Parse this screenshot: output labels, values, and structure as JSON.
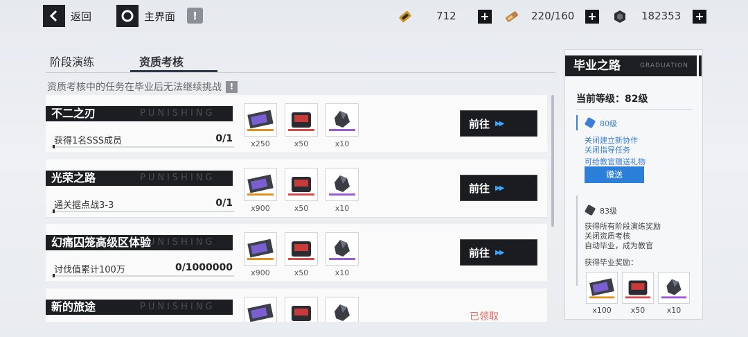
{
  "topbar": {
    "back_label": "返回",
    "home_label": "主界面",
    "warn_glyph": "!",
    "resources": [
      {
        "icon": "ticket-icon",
        "value": "712"
      },
      {
        "icon": "battery-icon",
        "value": "220/160"
      },
      {
        "icon": "coin-icon",
        "value": "182353"
      }
    ],
    "plus_glyph": "+"
  },
  "tabs": [
    "阶段演练",
    "资质考核"
  ],
  "active_tab": 1,
  "notice": {
    "text": "资质考核中的任务在毕业后无法继续挑战",
    "icon": "!"
  },
  "tasks": [
    {
      "title": "不二之刃",
      "watermark": "PUNISHING",
      "task": "获得1名SSS成员",
      "progress": "0/1",
      "rewards": [
        "x250",
        "x50",
        "x10"
      ],
      "action": "前往",
      "claimed": ""
    },
    {
      "title": "光荣之路",
      "watermark": "PUNISHING",
      "task": "通关据点战3-3",
      "progress": "0/1",
      "rewards": [
        "x900",
        "x50",
        "x10"
      ],
      "action": "前往",
      "claimed": ""
    },
    {
      "title": "幻痛囚笼高级区体验",
      "watermark": "PUNISHING",
      "task": "讨伐值累计100万",
      "progress": "0/1000000",
      "rewards": [
        "x900",
        "x50",
        "x10"
      ],
      "action": "前往",
      "claimed": ""
    },
    {
      "title": "新的旅途",
      "watermark": "PUNISHING",
      "task": "",
      "progress": "",
      "rewards": [
        "",
        "",
        ""
      ],
      "action": "",
      "claimed": "已领取"
    }
  ],
  "side": {
    "title": "毕业之路",
    "title_en": "GRADUATION",
    "current_level": "当前等级：82级",
    "level80": {
      "name": "80级",
      "lines": [
        "关闭建立新协作",
        "关闭指导任务"
      ],
      "extra": "可给教官赠送礼物",
      "button": "赠送"
    },
    "level83": {
      "name": "83级",
      "lines": [
        "获得所有阶段演练奖励",
        "关闭资质考核",
        "自动毕业，成为教官"
      ]
    },
    "reward_label": "获得毕业奖励：",
    "rewards": [
      "x100",
      "x50",
      "x10"
    ]
  },
  "colors": {
    "accent_blue": "#2c7fd8",
    "dark": "#1c1e22",
    "claimed_red": "#e06a62"
  }
}
